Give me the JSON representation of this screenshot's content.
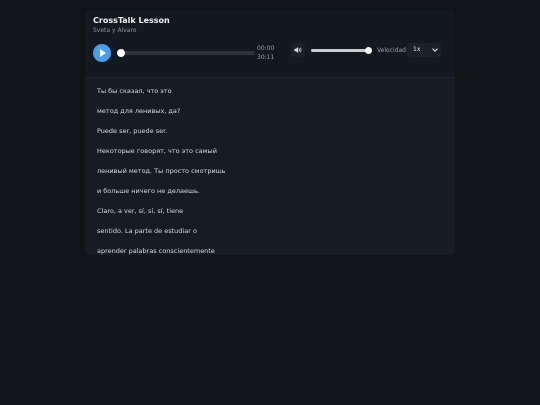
{
  "player": {
    "title": "CrossTalk Lesson",
    "subtitle": "Sveta y Alvaro",
    "play_icon": "play-icon",
    "current_time": "00:00",
    "duration": "30:11",
    "progress": 0.0,
    "volume_icon": "speaker-icon",
    "volume_level": 1.0,
    "speed_label": "Velocidad",
    "speed_value": "1x",
    "accent_color": "#4a9de8"
  },
  "transcript": {
    "lines": [
      "Ты бы сказал, что это",
      "метод для ленивых, да?",
      "Puede ser, puede ser.",
      "Некоторые говорят, что это самый",
      "ленивый метод. Ты просто смотришь",
      "и больше ничего не делаешь.",
      "Claro, a ver, sí, sí, sí, tiene",
      "sentido. La parte de estudiar o",
      "aprender palabras conscientemente"
    ]
  }
}
